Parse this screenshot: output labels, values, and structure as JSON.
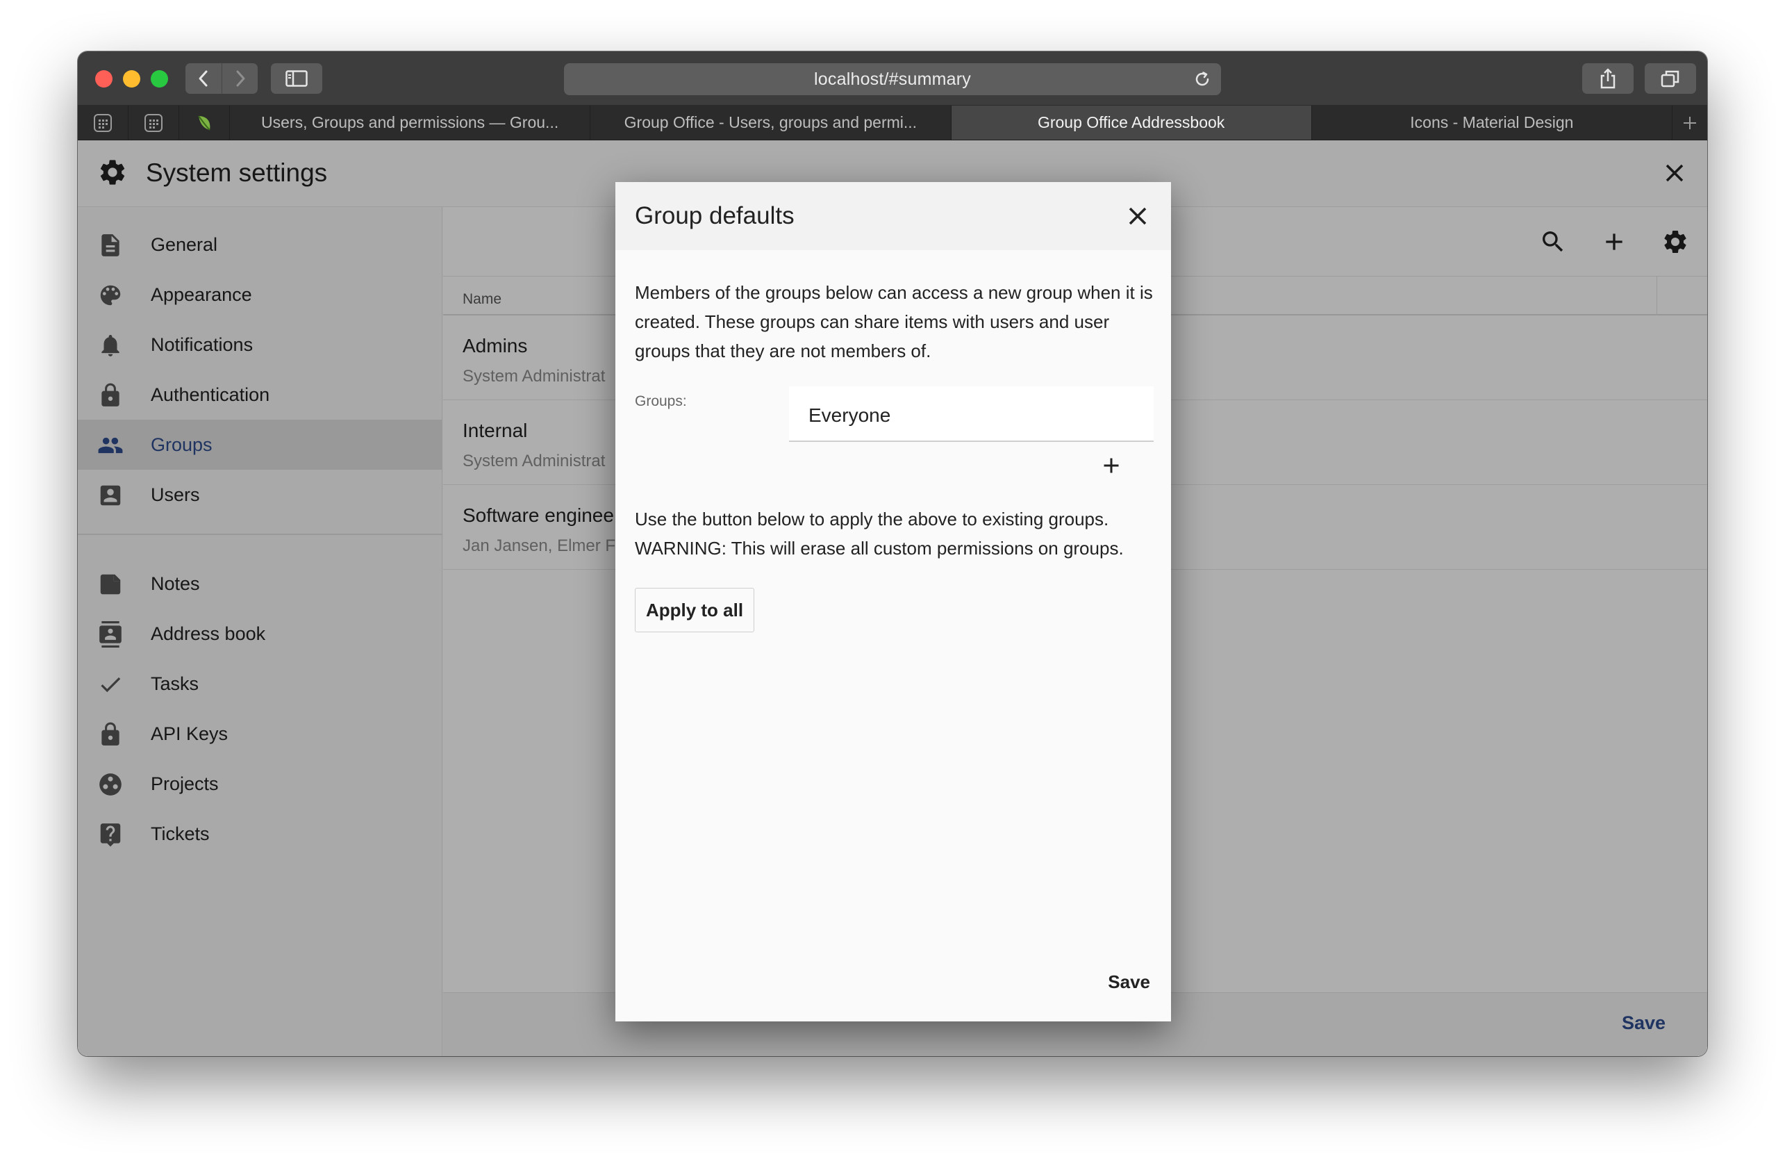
{
  "browser": {
    "url": "localhost/#summary",
    "tabs": [
      {
        "label": "Users, Groups and permissions — Grou...",
        "active": false
      },
      {
        "label": "Group Office - Users, groups and permi...",
        "active": false
      },
      {
        "label": "Group Office Addressbook",
        "active": true
      },
      {
        "label": "Icons - Material Design",
        "active": false
      }
    ]
  },
  "app": {
    "title": "System settings",
    "sidebar": {
      "items": [
        {
          "label": "General",
          "icon": "file-document-icon"
        },
        {
          "label": "Appearance",
          "icon": "palette-icon"
        },
        {
          "label": "Notifications",
          "icon": "bell-icon"
        },
        {
          "label": "Authentication",
          "icon": "lock-icon"
        },
        {
          "label": "Groups",
          "icon": "account-group-icon",
          "active": true
        },
        {
          "label": "Users",
          "icon": "account-box-icon"
        },
        {
          "label": "Notes",
          "icon": "note-icon"
        },
        {
          "label": "Address book",
          "icon": "contacts-icon"
        },
        {
          "label": "Tasks",
          "icon": "check-icon"
        },
        {
          "label": "API Keys",
          "icon": "lock-icon"
        },
        {
          "label": "Projects",
          "icon": "projects-icon"
        },
        {
          "label": "Tickets",
          "icon": "help-box-icon"
        }
      ]
    },
    "groups_table": {
      "column_name": "Name",
      "rows": [
        {
          "name": "Admins",
          "members": "System Administrat"
        },
        {
          "name": "Internal",
          "members": "System Administrat"
        },
        {
          "name": "Software enginee",
          "members": "Jan Jansen, Elmer F"
        }
      ]
    },
    "save_label": "Save"
  },
  "dialog": {
    "title": "Group defaults",
    "intro": "Members of the groups below can access a new group when it is created. These groups can share items with users and user groups that they are not members of.",
    "groups_label": "Groups:",
    "groups_value": "Everyone",
    "warning_line1": "Use the button below to apply the above to existing groups.",
    "warning_line2": "WARNING: This will erase all custom permissions on groups.",
    "apply_label": "Apply to all",
    "save_label": "Save"
  },
  "colors": {
    "accent": "#2f4b8c",
    "traffic_red": "#fe5f57",
    "traffic_yellow": "#febc2e",
    "traffic_green": "#28c840"
  }
}
